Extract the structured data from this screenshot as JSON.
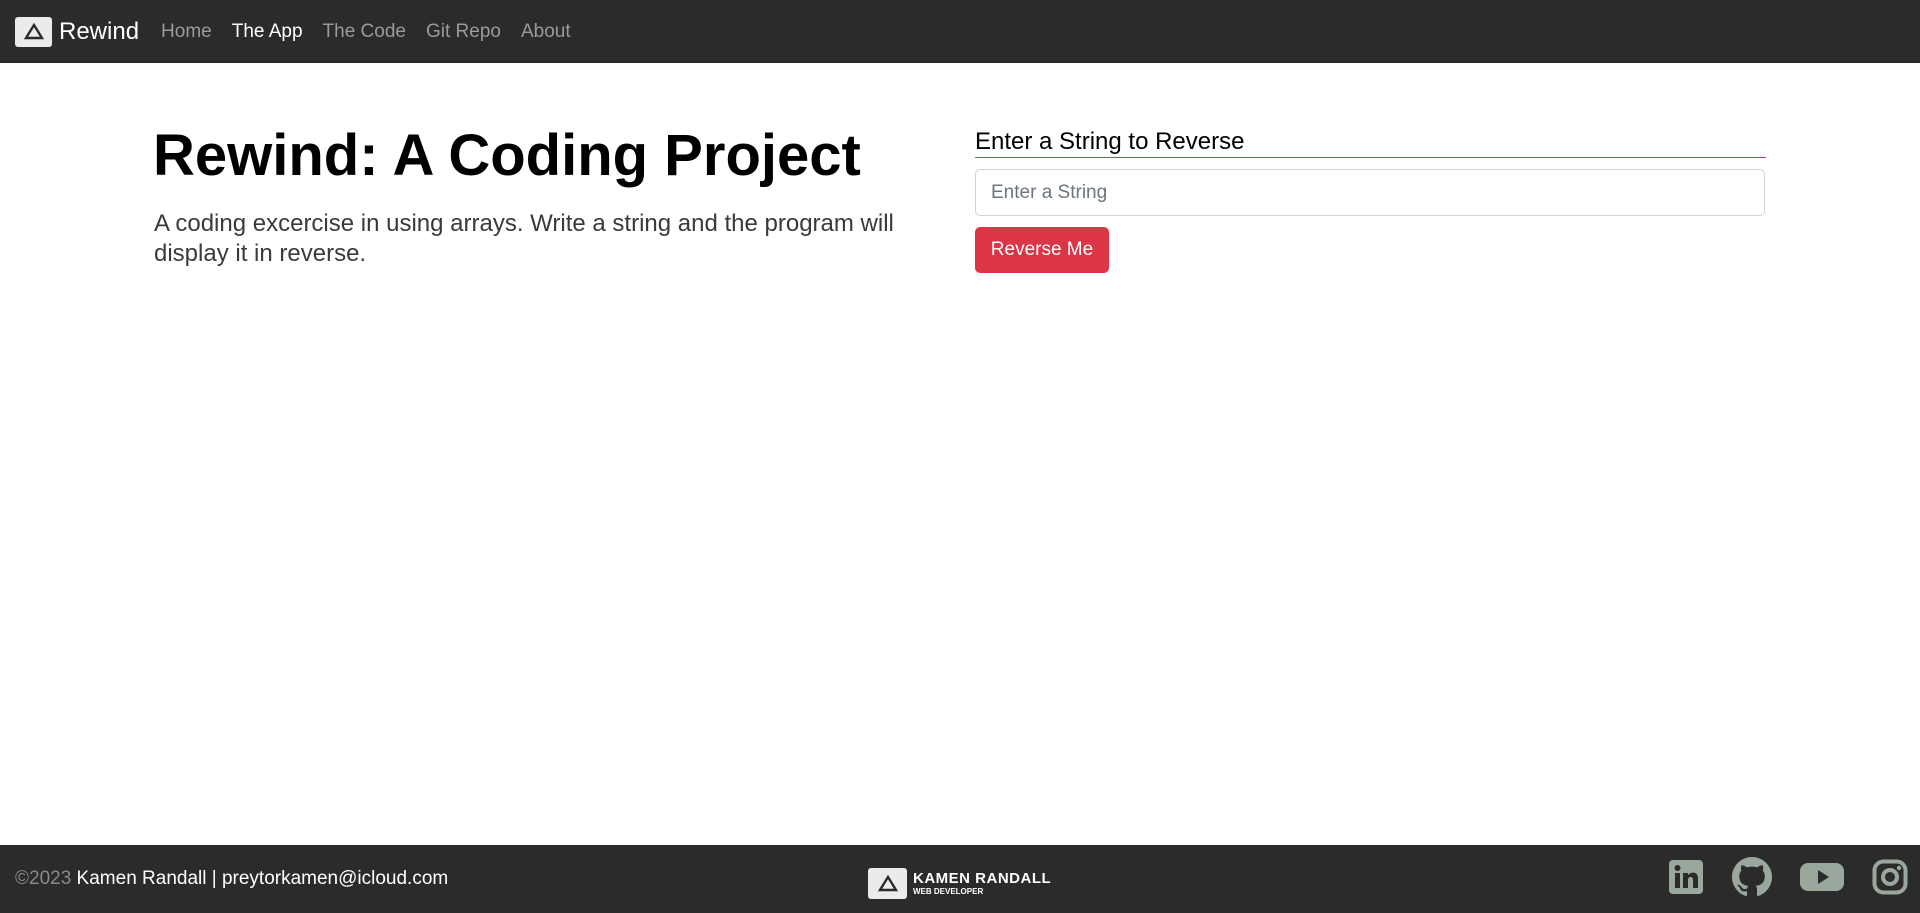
{
  "navbar": {
    "brand": "Rewind",
    "links": [
      "Home",
      "The App",
      "The Code",
      "Git Repo",
      "About"
    ],
    "active_link": "The App"
  },
  "main": {
    "title": "Rewind: A Coding Project",
    "lead": "A coding excercise in using arrays. Write a string and the program will display it in reverse.",
    "form_label": "Enter a String to Reverse",
    "input_placeholder": "Enter a String",
    "input_value": "",
    "button_label": "Reverse Me"
  },
  "footer": {
    "copyright_symbol_year": "©2023",
    "contact": " Kamen Randall | preytorkamen@icloud.com",
    "logo_name": "KAMEN RANDALL",
    "logo_role": "WEB DEVELOPER",
    "socials": [
      "linkedin-icon",
      "github-icon",
      "youtube-icon",
      "instagram-icon"
    ]
  },
  "colors": {
    "navbar_bg": "#2b2b2b",
    "accent": "#dc3545",
    "social_icon": "#9aa79d"
  }
}
